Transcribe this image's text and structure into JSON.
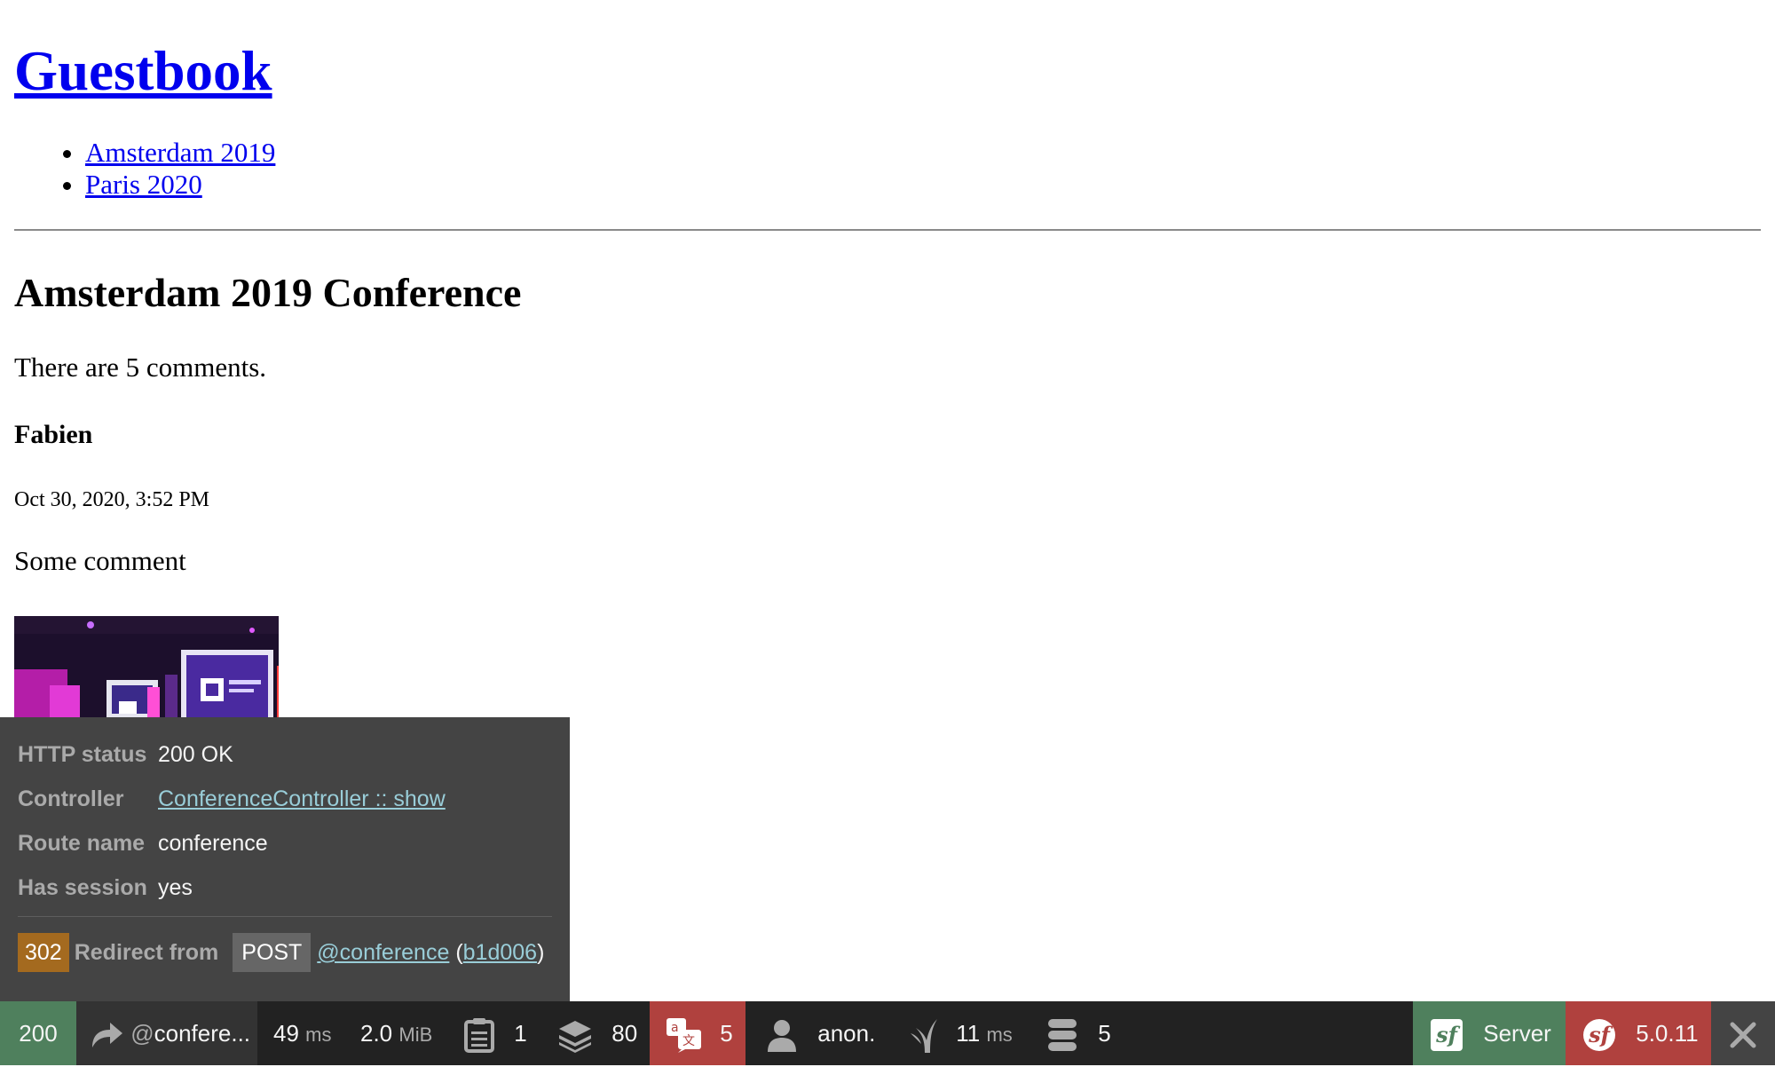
{
  "site": {
    "title": "Guestbook"
  },
  "nav": {
    "items": [
      {
        "label": "Amsterdam 2019"
      },
      {
        "label": "Paris 2020"
      }
    ]
  },
  "conference": {
    "title": "Amsterdam 2019 Conference",
    "comment_count_text": "There are 5 comments."
  },
  "comment": {
    "author": "Fabien",
    "date": "Oct 30, 2020, 3:52 PM",
    "text": "Some comment",
    "photo_icon": "conference-photo"
  },
  "panel": {
    "rows": [
      {
        "label": "HTTP status",
        "value": "200 OK"
      },
      {
        "label": "Controller",
        "value": "ConferenceController :: show"
      },
      {
        "label": "Route name",
        "value": "conference"
      },
      {
        "label": "Has session",
        "value": "yes"
      }
    ],
    "redirect": {
      "code": "302",
      "from_label": "Redirect from",
      "method": "POST",
      "route": "@conference",
      "open_paren": "(",
      "token": "b1d006",
      "close_paren": ")"
    }
  },
  "toolbar": {
    "status": "200",
    "request_at": "@",
    "request_route": "confere...",
    "time_value": "49",
    "time_unit": "ms",
    "memory_value": "2.0",
    "memory_unit": "MiB",
    "logs_count": "1",
    "cache_count": "80",
    "translation_count": "5",
    "user": "anon.",
    "twig_value": "11",
    "twig_unit": "ms",
    "db_count": "5",
    "server_label": "Server",
    "version": "5.0.11",
    "colors": {
      "success": "#4f805d",
      "error": "#b0413e",
      "redirect": "#a46a1f",
      "bar": "#222222",
      "panel": "#444444"
    }
  }
}
